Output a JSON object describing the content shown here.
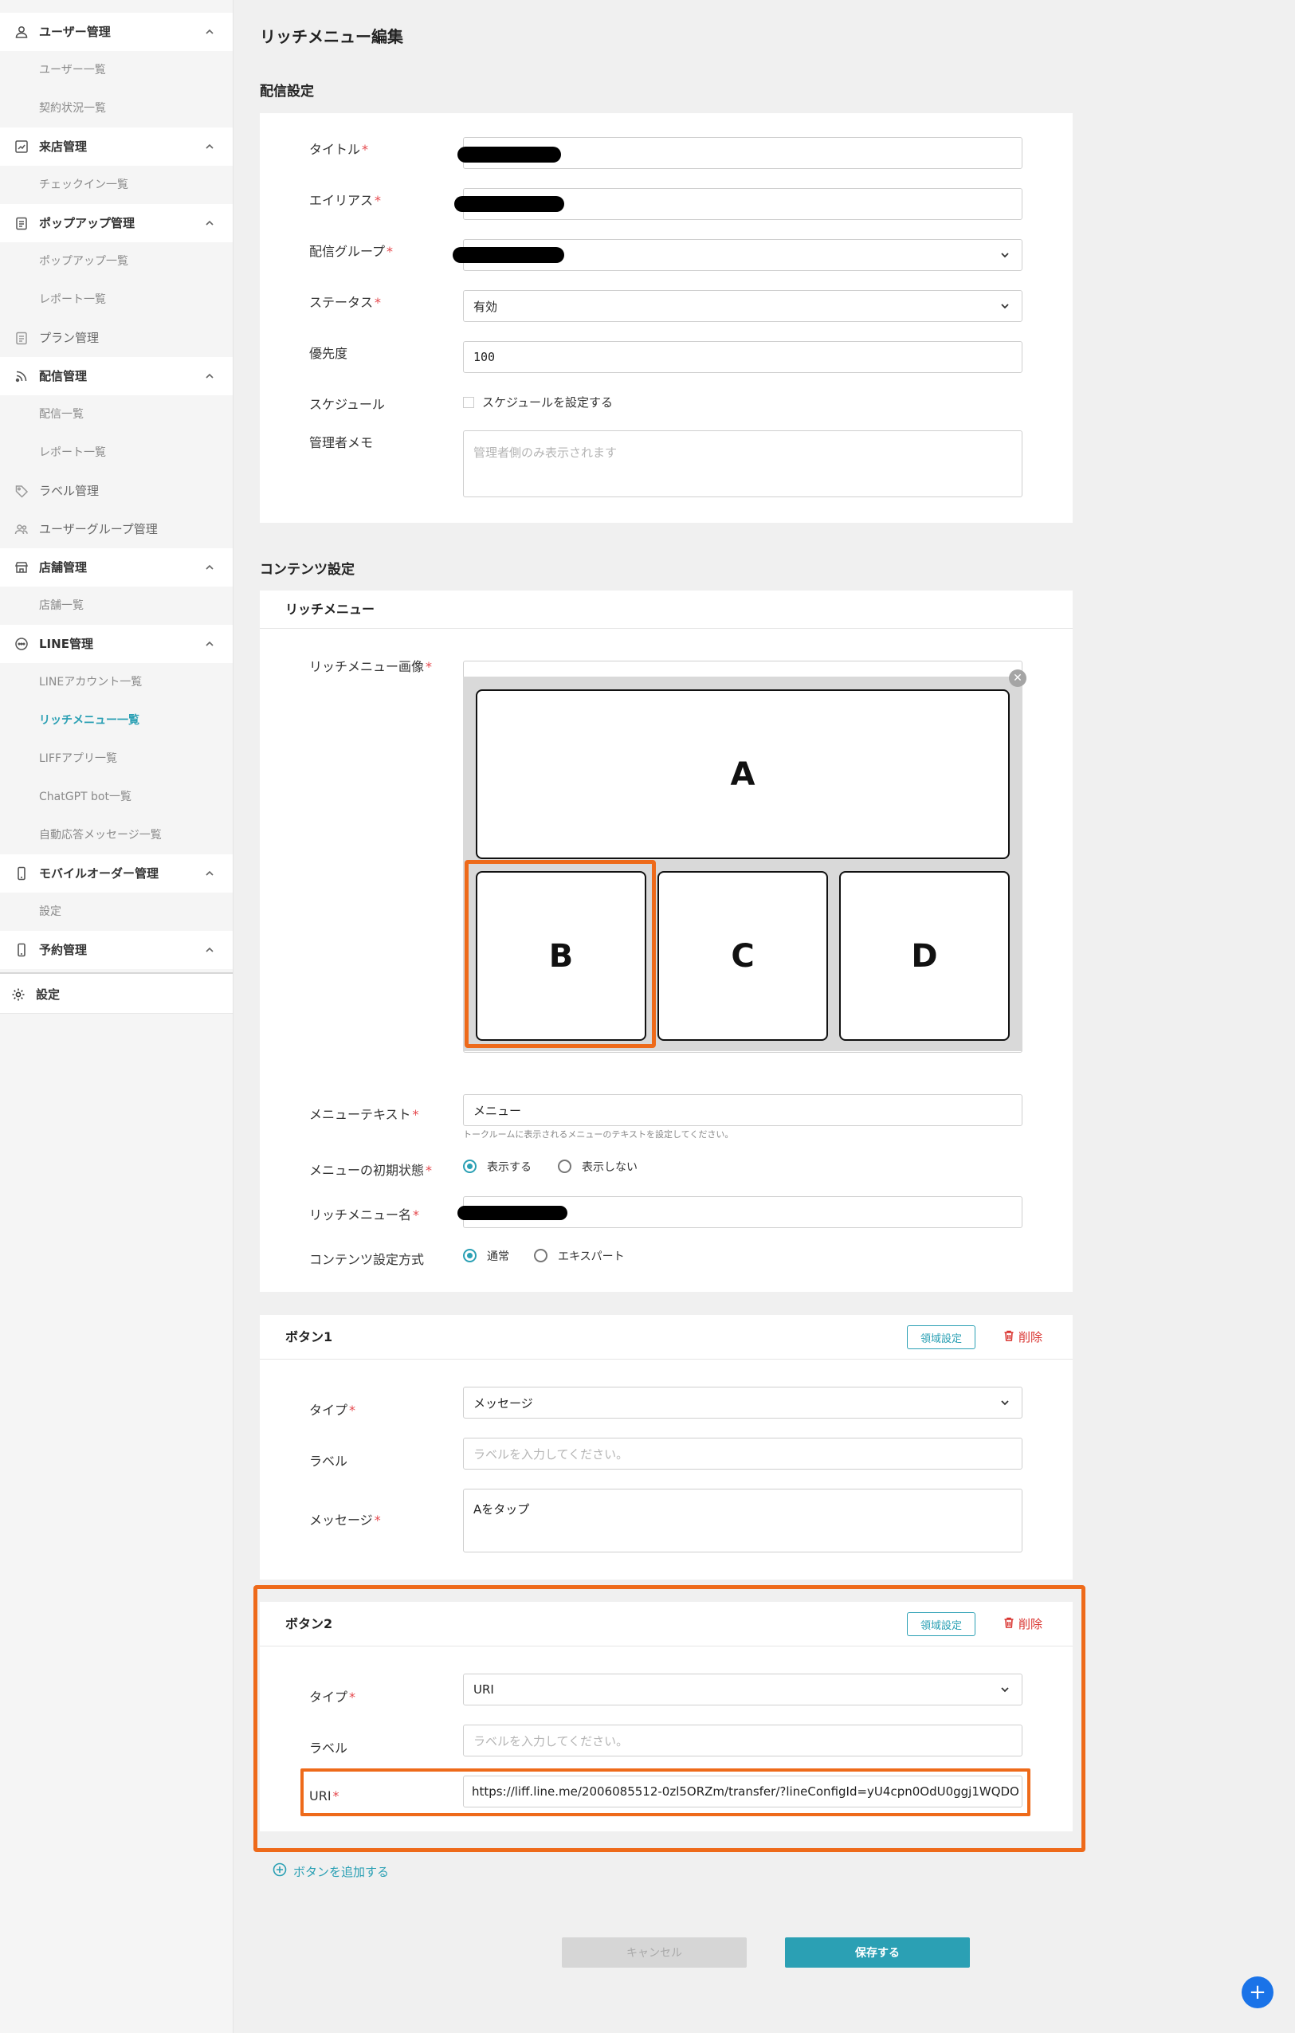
{
  "sidebar": {
    "user_mgmt": "ユーザー管理",
    "user_list": "ユーザー一覧",
    "contract_status": "契約状況一覧",
    "visit_mgmt": "来店管理",
    "checkin_list": "チェックイン一覧",
    "popup_mgmt": "ポップアップ管理",
    "popup_list": "ポップアップ一覧",
    "popup_report": "レポート一覧",
    "plan_mgmt": "プラン管理",
    "delivery_mgmt": "配信管理",
    "delivery_list": "配信一覧",
    "delivery_report": "レポート一覧",
    "label_mgmt": "ラベル管理",
    "usergroup_mgmt": "ユーザーグループ管理",
    "store_mgmt": "店舗管理",
    "store_list": "店舗一覧",
    "line_mgmt": "LINE管理",
    "line_account_list": "LINEアカウント一覧",
    "richmenu_list": "リッチメニュー一覧",
    "liff_list": "LIFFアプリ一覧",
    "chatgpt_list": "ChatGPT bot一覧",
    "auto_reply_list": "自動応答メッセージ一覧",
    "mobile_order_mgmt": "モバイルオーダー管理",
    "mobile_order_settings": "設定",
    "reservation_mgmt": "予約管理",
    "settings": "設定"
  },
  "page": {
    "title": "リッチメニュー編集",
    "delivery_settings": "配信設定",
    "content_settings": "コンテンツ設定"
  },
  "delivery": {
    "title_label": "タイトル",
    "alias_label": "エイリアス",
    "group_label": "配信グループ",
    "status_label": "ステータス",
    "status_value": "有効",
    "priority_label": "優先度",
    "priority_value": "100",
    "schedule_label": "スケジュール",
    "schedule_checkbox": "スケジュールを設定する",
    "memo_label": "管理者メモ",
    "memo_placeholder": "管理者側のみ表示されます"
  },
  "richmenu": {
    "card_title": "リッチメニュー",
    "image_label": "リッチメニュー画像",
    "tiles": {
      "a": "A",
      "b": "B",
      "c": "C",
      "d": "D"
    },
    "menu_text_label": "メニューテキスト",
    "menu_text_value": "メニュー",
    "menu_text_help": "トークルームに表示されるメニューのテキストを設定してください。",
    "initial_state_label": "メニューの初期状態",
    "show_label": "表示する",
    "hide_label": "表示しない",
    "name_label": "リッチメニュー名",
    "mode_label": "コンテンツ設定方式",
    "mode_normal": "通常",
    "mode_expert": "エキスパート"
  },
  "button1": {
    "title": "ボタン1",
    "area_settings": "領域設定",
    "delete": "削除",
    "type_label": "タイプ",
    "type_value": "メッセージ",
    "label_label": "ラベル",
    "label_placeholder": "ラベルを入力してください。",
    "message_label": "メッセージ",
    "message_value": "Aをタップ"
  },
  "button2": {
    "title": "ボタン2",
    "area_settings": "領域設定",
    "delete": "削除",
    "type_label": "タイプ",
    "type_value": "URI",
    "label_label": "ラベル",
    "label_placeholder": "ラベルを入力してください。",
    "uri_label": "URI",
    "uri_value": "https://liff.line.me/2006085512-0zl5ORZm/transfer/?lineConfigId=yU4cpn0OdU0ggj1WQDO"
  },
  "actions": {
    "add_button": "ボタンを追加する",
    "cancel": "キャンセル",
    "save": "保存する"
  },
  "colors": {
    "accent": "#2ba0b4",
    "highlight": "#ee6a1a",
    "required": "#e5484d",
    "danger": "#d9332f",
    "fab": "#1a73e8"
  }
}
